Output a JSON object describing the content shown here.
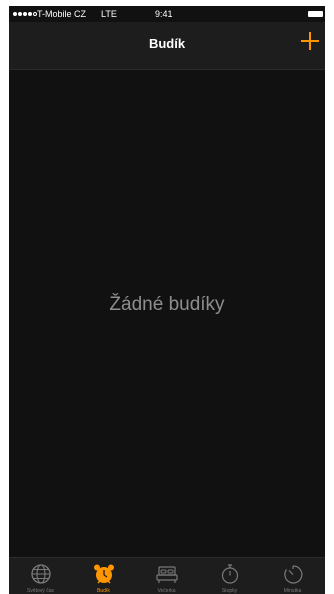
{
  "status_bar": {
    "carrier": "T-Mobile CZ",
    "network": "LTE",
    "time": "9:41"
  },
  "nav": {
    "title": "Budík",
    "add_icon": "plus-icon"
  },
  "content": {
    "empty_message": "Žádné budíky"
  },
  "tabs": [
    {
      "label": "Světový čas",
      "icon": "globe-icon",
      "active": false
    },
    {
      "label": "Budík",
      "icon": "alarm-clock-icon",
      "active": true
    },
    {
      "label": "Večerka",
      "icon": "bed-icon",
      "active": false
    },
    {
      "label": "Stopky",
      "icon": "stopwatch-icon",
      "active": false
    },
    {
      "label": "Minutka",
      "icon": "timer-icon",
      "active": false
    }
  ],
  "colors": {
    "accent": "#ff9500",
    "background": "#111111",
    "bar": "#1d1d1d",
    "inactive": "#7a7a7a",
    "placeholder_text": "#8e8e8e"
  }
}
